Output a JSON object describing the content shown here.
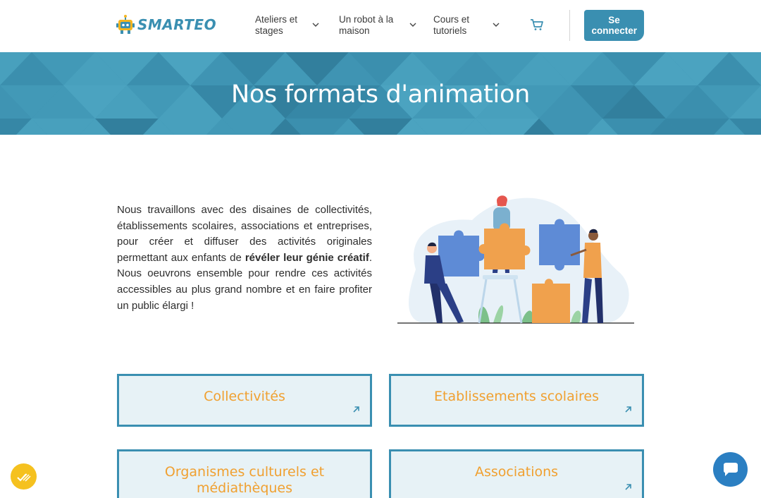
{
  "header": {
    "logo_text": "SMARTEO",
    "nav": [
      {
        "label": "Ateliers et stages"
      },
      {
        "label": "Un robot à la maison"
      },
      {
        "label": "Cours et tutoriels"
      }
    ],
    "login_label": "Se connecter"
  },
  "banner": {
    "title": "Nos formats d'animation"
  },
  "intro": {
    "text_before": "Nous travaillons avec des disaines de collectivités, établissements scolaires, associations et entreprises, pour créer et diffuser des activités originales permettant aux enfants de ",
    "text_bold": "révéler leur génie créatif",
    "text_after": ". Nous oeuvrons ensemble pour rendre ces activités accessibles au plus grand nombre et en faire profiter un public élargi !"
  },
  "cards": [
    {
      "title": "Collectivités"
    },
    {
      "title": "Etablissements scolaires"
    },
    {
      "title": "Organismes culturels et médiathèques"
    },
    {
      "title": "Associations"
    }
  ],
  "colors": {
    "brand_blue": "#3a8fb1",
    "accent_orange": "#f0a030",
    "card_bg": "#e7f2f6",
    "cookie_yellow": "#f5c11f",
    "chat_blue": "#2b7fc2"
  },
  "icons": {
    "nav_dropdown": "chevron-down-icon",
    "cart": "cart-icon",
    "card_link": "arrow-up-right-icon",
    "cookie": "cookie-consent-icon",
    "chat": "chat-bubble-icon"
  }
}
